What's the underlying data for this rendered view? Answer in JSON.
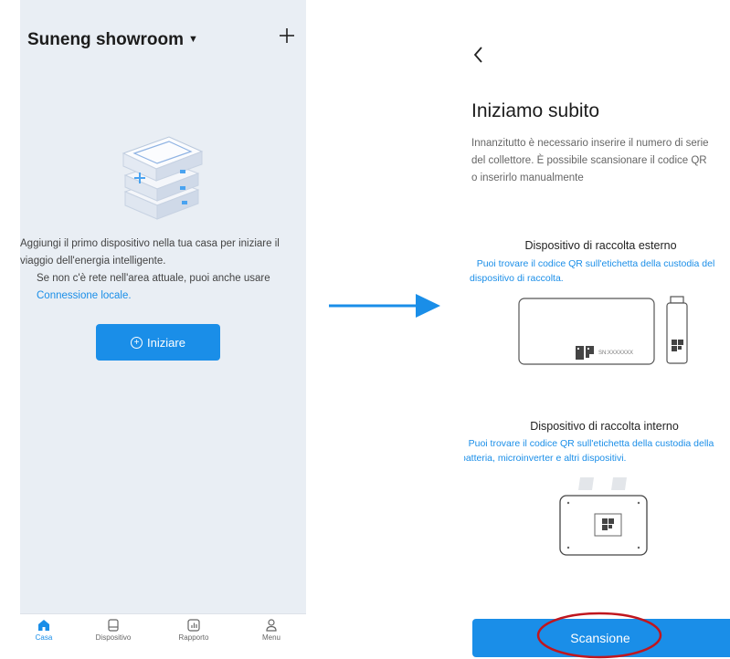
{
  "left": {
    "home_title": "Suneng showroom",
    "intro_line1": "Aggiungi il primo dispositivo nella tua casa per iniziare il",
    "intro_line2": "viaggio dell'energia intelligente.",
    "intro_line3": "Se non c'è rete nell'area attuale, puoi anche usare",
    "local_link": "Connessione locale.",
    "start_button": "Iniziare",
    "nav": [
      {
        "label": "Casa",
        "icon": "home-icon"
      },
      {
        "label": "Dispositivo",
        "icon": "device-icon"
      },
      {
        "label": "Rapporto",
        "icon": "report-icon"
      },
      {
        "label": "Menu",
        "icon": "user-icon"
      }
    ]
  },
  "right": {
    "title": "Iniziamo subito",
    "desc_line1": "Innanzitutto è necessario inserire il numero di serie",
    "desc_line2": "del collettore. È possibile scansionare il codice QR",
    "desc_line3": "o inserirlo manualmente",
    "external": {
      "title": "Dispositivo di raccolta esterno",
      "desc_line1": "Puoi trovare il codice QR sull'etichetta della custodia del",
      "desc_line2": "dispositivo di raccolta.",
      "sn_label": "SN:XXXXXXX"
    },
    "internal": {
      "title": "Dispositivo di raccolta interno",
      "desc_line1": "Puoi trovare il codice QR sull'etichetta della custodia della",
      "desc_line2": "batteria, microinverter e altri dispositivi."
    },
    "scan_button": "Scansione"
  },
  "colors": {
    "accent": "#1a8ee8",
    "highlight": "#c0161e",
    "left_bg": "#e9eef4"
  }
}
